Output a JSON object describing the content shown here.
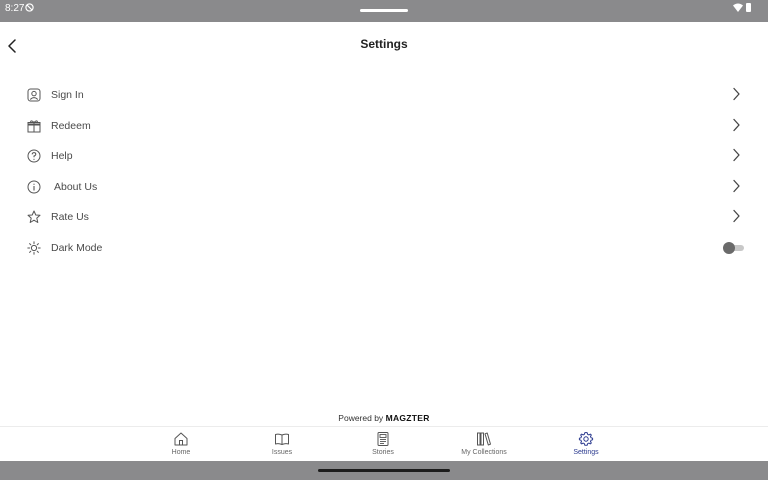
{
  "status_bar": {
    "time": "8:27"
  },
  "header": {
    "title": "Settings"
  },
  "settings": {
    "items": [
      {
        "label": "Sign In",
        "icon": "account-icon",
        "trailing": "chevron"
      },
      {
        "label": "Redeem",
        "icon": "gift-icon",
        "trailing": "chevron"
      },
      {
        "label": "Help",
        "icon": "help-circle-icon",
        "trailing": "chevron"
      },
      {
        "label": "About Us",
        "icon": "info-icon",
        "trailing": "chevron"
      },
      {
        "label": "Rate Us",
        "icon": "star-icon",
        "trailing": "chevron"
      },
      {
        "label": "Dark Mode",
        "icon": "sun-icon",
        "trailing": "toggle",
        "toggle_on": false
      }
    ]
  },
  "footer": {
    "powered_prefix": "Powered by",
    "powered_brand": "MAGZTER"
  },
  "bottom_nav": {
    "items": [
      {
        "label": "Home",
        "icon": "home-icon"
      },
      {
        "label": "Issues",
        "icon": "book-open-icon"
      },
      {
        "label": "Stories",
        "icon": "document-icon"
      },
      {
        "label": "My Collections",
        "icon": "library-icon"
      },
      {
        "label": "Settings",
        "icon": "gear-icon"
      }
    ],
    "active": "Settings",
    "active_color": "#2b3a8f"
  },
  "colors": {
    "system_bar": "#8a8a8c",
    "text": "#4a4a4a"
  }
}
